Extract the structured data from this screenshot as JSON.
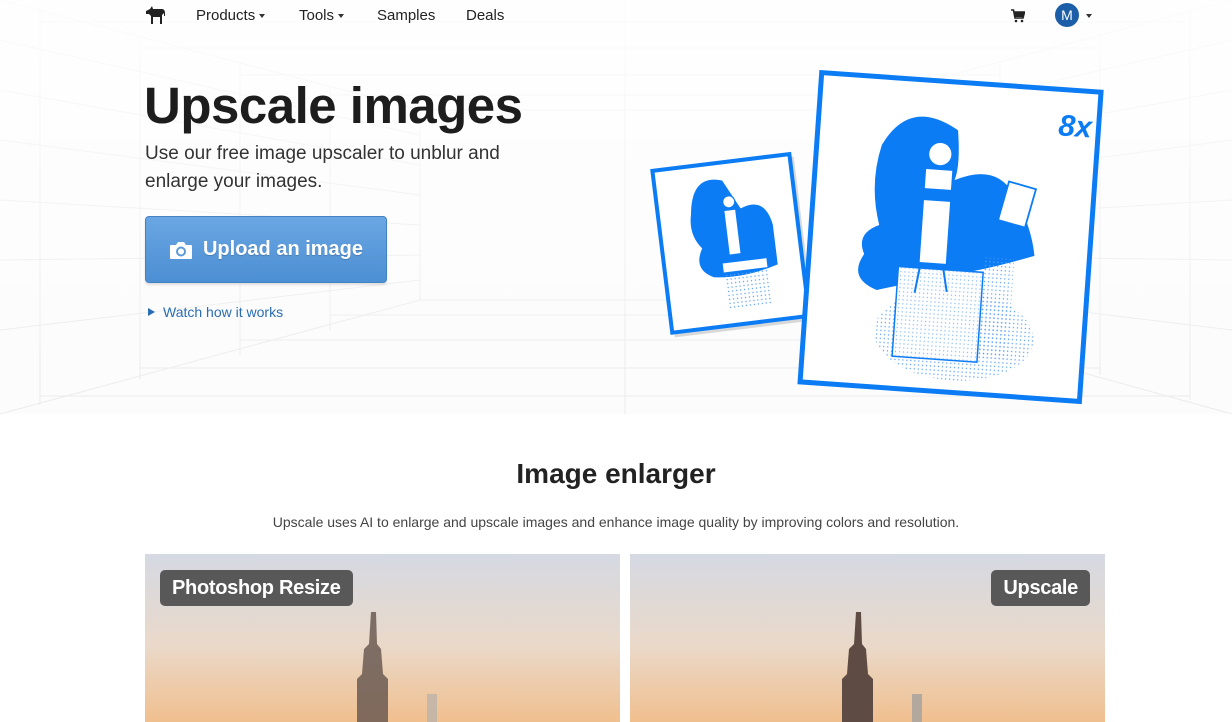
{
  "nav": {
    "items": [
      {
        "label": "Products",
        "has_caret": true
      },
      {
        "label": "Tools",
        "has_caret": true
      },
      {
        "label": "Samples",
        "has_caret": false
      },
      {
        "label": "Deals",
        "has_caret": false
      }
    ],
    "avatar_initial": "M",
    "icons": [
      "zebra-logo-icon",
      "cart-icon",
      "chevron-down-icon"
    ]
  },
  "hero": {
    "title": "Upscale images",
    "subtitle": "Use our free image upscaler to unblur and enlarge your images.",
    "upload_label": "Upload an image",
    "watch_label": "Watch how it works",
    "zoom_badge": "8x"
  },
  "section": {
    "title": "Image enlarger",
    "description": "Upscale uses AI to enlarge and upscale images and enhance image quality by improving colors and resolution."
  },
  "compare": {
    "left_label": "Photoshop Resize",
    "right_label": "Upscale"
  },
  "colors": {
    "accent": "#0c7cf5",
    "button": "#5b9bdc",
    "link": "#2a6db5",
    "avatar": "#1c5fa8"
  }
}
